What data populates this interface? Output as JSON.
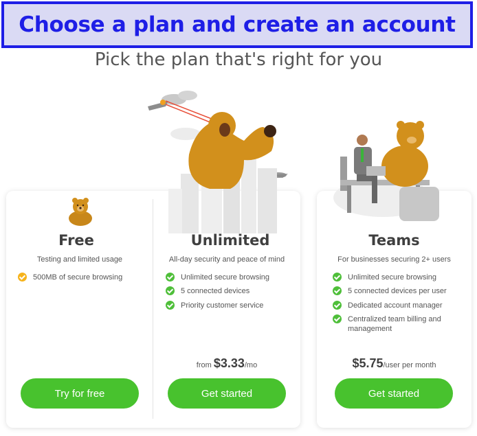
{
  "banner": {
    "title": "Choose a plan and create an account"
  },
  "subtitle": "Pick the plan that's right for you",
  "colors": {
    "banner_border": "#1e1ee6",
    "banner_bg": "#dadaf4",
    "button_green": "#48c22e",
    "check_green": "#4fbf3a",
    "check_orange": "#f6b31b",
    "bear_brown": "#d2901c"
  },
  "plans": [
    {
      "title": "Free",
      "description": "Testing and limited usage",
      "features": [
        "500MB of secure browsing"
      ],
      "feature_icon": "check-circle-orange-icon",
      "price": null,
      "button_label": "Try for free"
    },
    {
      "title": "Unlimited",
      "description": "All-day security and peace of mind",
      "features": [
        "Unlimited secure browsing",
        "5 connected devices",
        "Priority customer service"
      ],
      "feature_icon": "check-circle-green-icon",
      "price": {
        "prefix": "from ",
        "amount": "$3.33",
        "suffix": "/mo"
      },
      "button_label": "Get started"
    },
    {
      "title": "Teams",
      "description": "For businesses securing 2+ users",
      "features": [
        "Unlimited secure browsing",
        "5 connected devices per user",
        "Dedicated account manager",
        "Centralized team billing and management"
      ],
      "feature_icon": "check-circle-green-icon",
      "price": {
        "prefix": "",
        "amount": "$5.75",
        "suffix": "/user per month"
      },
      "button_label": "Get started"
    }
  ]
}
